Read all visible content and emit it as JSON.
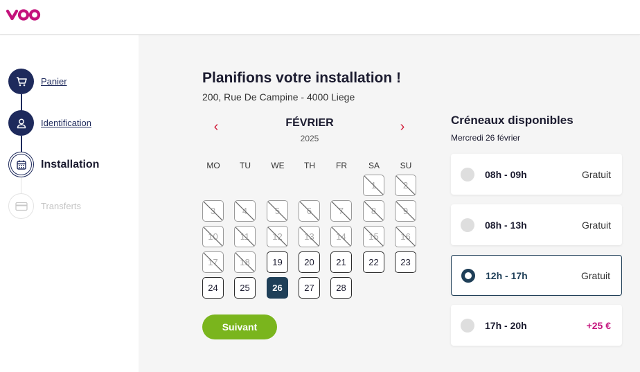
{
  "brand": {
    "logo_color": "#c4127c",
    "logo_name": "voo"
  },
  "steps": [
    {
      "label": "Panier",
      "state": "done",
      "icon": "cart-icon"
    },
    {
      "label": "Identification",
      "state": "done",
      "icon": "user-icon"
    },
    {
      "label": "Installation",
      "state": "current",
      "icon": "calendar-icon"
    },
    {
      "label": "Transferts",
      "state": "todo",
      "icon": "card-icon"
    }
  ],
  "main": {
    "title": "Planifions votre installation !",
    "address": "200, Rue De Campine - 4000 Liege"
  },
  "calendar": {
    "month": "FÉVRIER",
    "year": "2025",
    "prev_icon": "chevron-left-icon",
    "next_icon": "chevron-right-icon",
    "weekdays": [
      "MO",
      "TU",
      "WE",
      "TH",
      "FR",
      "SA",
      "SU"
    ],
    "weeks": [
      [
        null,
        null,
        null,
        null,
        null,
        {
          "d": "1",
          "off": true
        },
        {
          "d": "2",
          "off": true
        }
      ],
      [
        {
          "d": "3",
          "off": true
        },
        {
          "d": "4",
          "off": true
        },
        {
          "d": "5",
          "off": true
        },
        {
          "d": "6",
          "off": true
        },
        {
          "d": "7",
          "off": true
        },
        {
          "d": "8",
          "off": true
        },
        {
          "d": "9",
          "off": true
        }
      ],
      [
        {
          "d": "10",
          "off": true
        },
        {
          "d": "11",
          "off": true
        },
        {
          "d": "12",
          "off": true
        },
        {
          "d": "13",
          "off": true
        },
        {
          "d": "14",
          "off": true
        },
        {
          "d": "15",
          "off": true
        },
        {
          "d": "16",
          "off": true
        }
      ],
      [
        {
          "d": "17",
          "off": true
        },
        {
          "d": "18",
          "off": true
        },
        {
          "d": "19"
        },
        {
          "d": "20"
        },
        {
          "d": "21"
        },
        {
          "d": "22"
        },
        {
          "d": "23"
        }
      ],
      [
        {
          "d": "24"
        },
        {
          "d": "25"
        },
        {
          "d": "26",
          "sel": true
        },
        {
          "d": "27"
        },
        {
          "d": "28"
        },
        null,
        null
      ]
    ],
    "next_button": "Suivant"
  },
  "slots": {
    "title": "Créneaux disponibles",
    "date": "Mercredi 26 février",
    "items": [
      {
        "time": "08h - 09h",
        "price": "Gratuit",
        "selected": false,
        "extra": false
      },
      {
        "time": "08h - 13h",
        "price": "Gratuit",
        "selected": false,
        "extra": false
      },
      {
        "time": "12h - 17h",
        "price": "Gratuit",
        "selected": true,
        "extra": false
      },
      {
        "time": "17h - 20h",
        "price": "+25 €",
        "selected": false,
        "extra": true
      }
    ]
  },
  "colors": {
    "navy": "#1e2a5c",
    "selected_teal": "#1f3f58",
    "accent_red": "#d11d3a",
    "button_green": "#7ab51d",
    "price_magenta": "#c4127c"
  }
}
